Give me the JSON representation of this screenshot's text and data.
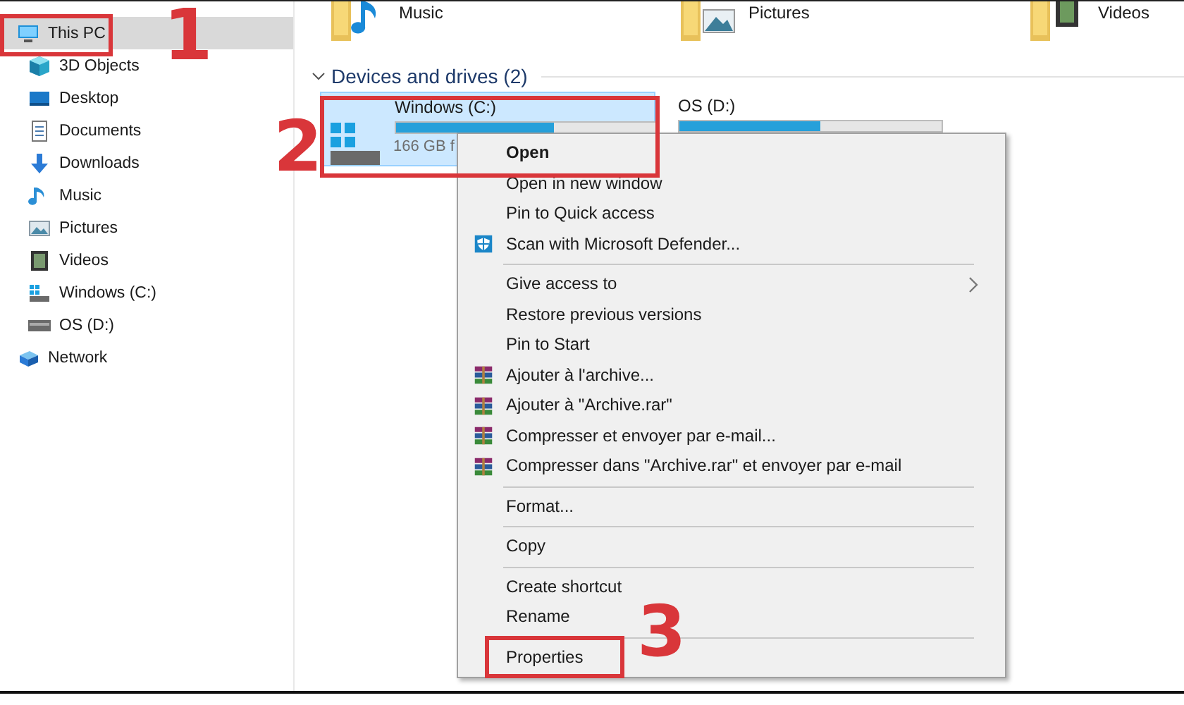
{
  "folders": [
    {
      "name": "Music",
      "kind": "music"
    },
    {
      "name": "Pictures",
      "kind": "pictures"
    },
    {
      "name": "Videos",
      "kind": "videos"
    }
  ],
  "sidebar": {
    "items": [
      {
        "label": "This PC",
        "kind": "pc",
        "selected": true,
        "children": [
          {
            "label": "3D Objects",
            "kind": "objects",
            "selected": false
          },
          {
            "label": "Desktop",
            "kind": "desktop",
            "selected": false
          },
          {
            "label": "Documents",
            "kind": "documents",
            "selected": false
          },
          {
            "label": "Downloads",
            "kind": "downloads",
            "selected": false
          },
          {
            "label": "Music",
            "kind": "music",
            "selected": false
          },
          {
            "label": "Pictures",
            "kind": "pictures",
            "selected": false
          },
          {
            "label": "Videos",
            "kind": "videos",
            "selected": false
          },
          {
            "label": "Windows (C:)",
            "kind": "windrive",
            "selected": false
          },
          {
            "label": "OS (D:)",
            "kind": "drive",
            "selected": false
          }
        ]
      },
      {
        "label": "Network",
        "kind": "network",
        "selected": false
      }
    ]
  },
  "section": {
    "title": "Devices and drives (2)",
    "expanded": true
  },
  "drives": [
    {
      "name": "Windows (C:)",
      "kind": "windrive",
      "selected": true,
      "level": 0.6,
      "free": "166 GB f"
    },
    {
      "name": "OS (D:)",
      "selected": false,
      "level": 0.54
    }
  ],
  "context_menu": {
    "items": [
      {
        "kind": "item",
        "label": "Open",
        "default": true
      },
      {
        "kind": "item",
        "label": "Open in new window"
      },
      {
        "kind": "item",
        "label": "Pin to Quick access"
      },
      {
        "kind": "scan",
        "label": "Scan with Microsoft Defender..."
      },
      {
        "kind": "separator"
      },
      {
        "kind": "item",
        "label": "Give access to",
        "submenu": true
      },
      {
        "kind": "item",
        "label": "Restore previous versions"
      },
      {
        "kind": "item",
        "label": "Pin to Start"
      },
      {
        "kind": "archive",
        "label": "Ajouter à l'archive..."
      },
      {
        "kind": "archive",
        "label": "Ajouter à \"Archive.rar\""
      },
      {
        "kind": "archive",
        "label": "Compresser et envoyer par e-mail..."
      },
      {
        "kind": "archive",
        "label": "Compresser dans \"Archive.rar\" et envoyer par e-mail"
      },
      {
        "kind": "separator"
      },
      {
        "kind": "item",
        "label": "Format..."
      },
      {
        "kind": "separator"
      },
      {
        "kind": "item",
        "label": "Copy"
      },
      {
        "kind": "separator"
      },
      {
        "kind": "item",
        "label": "Create shortcut"
      },
      {
        "kind": "item",
        "label": "Rename"
      },
      {
        "kind": "separator"
      },
      {
        "kind": "item",
        "label": "Properties"
      }
    ]
  },
  "annotations": [
    {
      "label": "1"
    },
    {
      "label": "2"
    },
    {
      "label": "3"
    }
  ]
}
